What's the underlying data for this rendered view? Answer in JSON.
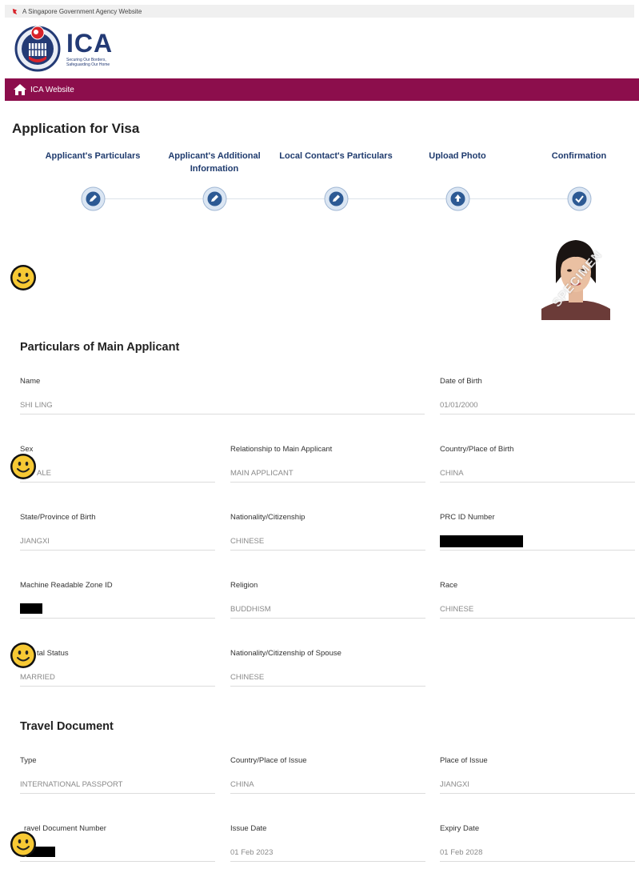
{
  "gov_banner": {
    "text": "A Singapore Government Agency Website"
  },
  "brand": {
    "name": "ICA",
    "tagline": "Securing Our Borders, Safeguarding Our Home",
    "accent_color": "#8c0e4c",
    "brand_blue": "#233a75"
  },
  "navbar": {
    "home_label": "ICA Website"
  },
  "page": {
    "title": "Application for Visa"
  },
  "steps": [
    {
      "label": "Applicant's Particulars",
      "icon": "pencil-badge-icon"
    },
    {
      "label": "Applicant's Additional Information",
      "icon": "pencil-badge-icon"
    },
    {
      "label": "Local Contact's Particulars",
      "icon": "pencil-badge-icon"
    },
    {
      "label": "Upload Photo",
      "icon": "upload-badge-icon"
    },
    {
      "label": "Confirmation",
      "icon": "check-badge-icon"
    }
  ],
  "photo": {
    "watermark": "SPECIMEN"
  },
  "main_applicant": {
    "title": "Particulars of Main Applicant",
    "fields": {
      "name": {
        "label": "Name",
        "value": "SHI LING"
      },
      "dob": {
        "label": "Date of Birth",
        "value": "01/01/2000"
      },
      "sex": {
        "label": "Sex",
        "value": "ALE"
      },
      "relationship": {
        "label": "Relationship to Main Applicant",
        "value": "MAIN APPLICANT"
      },
      "birth_country": {
        "label": "Country/Place of Birth",
        "value": "CHINA"
      },
      "birth_state": {
        "label": "State/Province of Birth",
        "value": "JIANGXI"
      },
      "nationality": {
        "label": "Nationality/Citizenship",
        "value": "CHINESE"
      },
      "prc_id": {
        "label": "PRC ID Number"
      },
      "mrz_id": {
        "label": "Machine Readable Zone ID"
      },
      "religion": {
        "label": "Religion",
        "value": "BUDDHISM"
      },
      "race": {
        "label": "Race",
        "value": "CHINESE"
      },
      "marital": {
        "label": "tal Status",
        "value": "MARRIED"
      },
      "spouse_nationality": {
        "label": "Nationality/Citizenship of Spouse",
        "value": "CHINESE"
      }
    }
  },
  "travel_document": {
    "title": "Travel Document",
    "fields": {
      "type": {
        "label": "Type",
        "value": "INTERNATIONAL PASSPORT"
      },
      "issue_country": {
        "label": "Country/Place of Issue",
        "value": "CHINA"
      },
      "issue_place": {
        "label": "Place of Issue",
        "value": "JIANGXI"
      },
      "doc_number": {
        "label": "ravel Document Number"
      },
      "issue_date": {
        "label": "Issue Date",
        "value": "01 Feb 2023"
      },
      "expiry_date": {
        "label": "Expiry Date",
        "value": "01 Feb 2028"
      }
    }
  }
}
